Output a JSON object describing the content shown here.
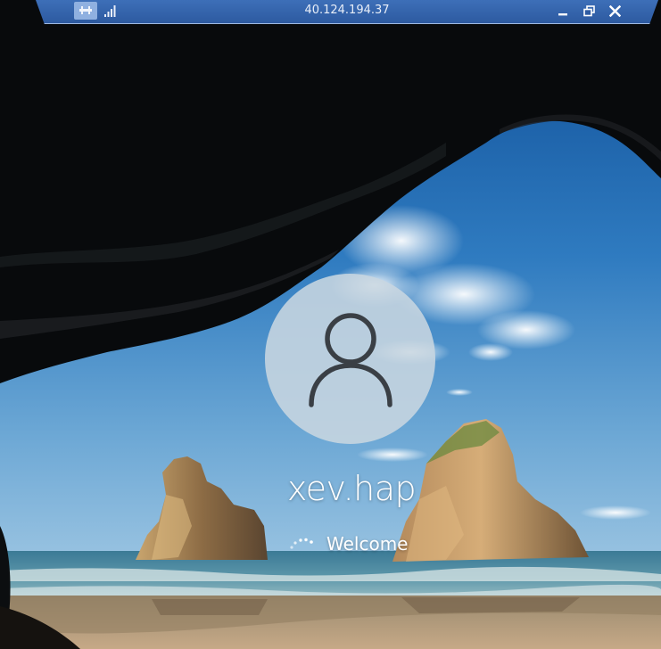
{
  "rdp_bar": {
    "title": "40.124.194.37",
    "icons": {
      "pin": "pin-icon",
      "signal": "connection-quality-icon",
      "minimize": "minimize-icon",
      "restore": "restore-icon",
      "close": "close-icon"
    }
  },
  "login": {
    "avatar_icon": "user-silhouette-icon",
    "username": "xev.hap",
    "status": "Welcome",
    "spinner_icon": "loading-spinner-icon"
  },
  "colors": {
    "rdp_bar": "#2d5aa0",
    "text": "#ffffff",
    "avatar_fill": "#c8d6e0"
  }
}
